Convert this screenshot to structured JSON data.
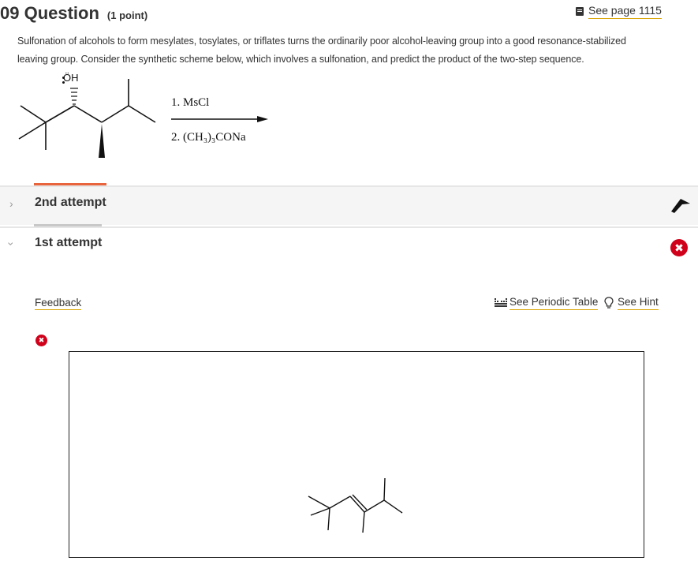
{
  "question": {
    "number": "09 Question",
    "points": "(1 point)",
    "see_page": "See page 1115",
    "text_line1": "Sulfonation of alcohols to form mesylates, tosylates, or triflates turns the ordinarily poor alcohol-leaving group into a good resonance-stabilized",
    "text_line2": "leaving group. Consider the synthetic scheme below, which involves a sulfonation, and predict the product of the two-step sequence.",
    "oh_label": "ÖH",
    "reagent1": "1. MsCl",
    "reagent2": "2. (CH₃)₃CONa"
  },
  "attempts": [
    {
      "label": "2nd attempt",
      "state": "collapsed"
    },
    {
      "label": "1st attempt",
      "state": "expanded"
    }
  ],
  "links": {
    "feedback": "Feedback",
    "periodic_table": "See Periodic Table",
    "hint": "See Hint"
  },
  "colors": {
    "error_red": "#d0021b",
    "accent_orange": "#e8643c",
    "link_underline": "#d9a400"
  },
  "icons": [
    "book-icon",
    "chevron-right-icon",
    "chevron-down-icon",
    "flag-icon",
    "error-x-icon",
    "periodic-table-icon",
    "lightbulb-icon"
  ]
}
